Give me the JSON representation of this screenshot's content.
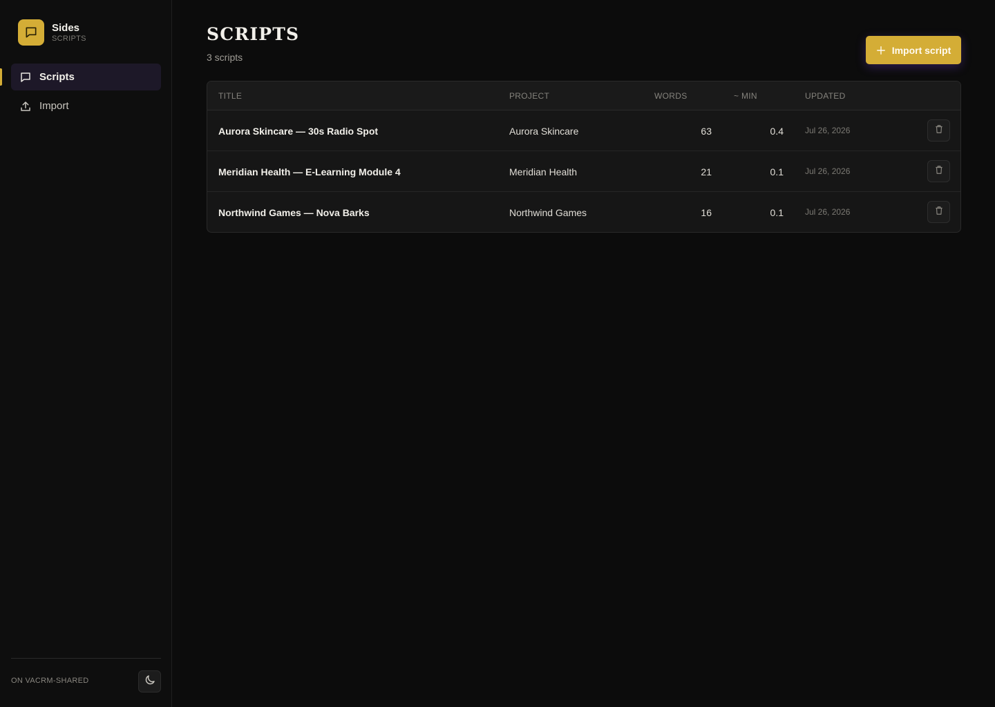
{
  "brand": {
    "name": "Sides",
    "subtitle": "SCRIPTS",
    "logo_icon": "chat-bubble-icon",
    "accent": "#d4ad36"
  },
  "nav": {
    "items": [
      {
        "label": "Scripts",
        "icon": "chat-bubble-icon",
        "active": true
      },
      {
        "label": "Import",
        "icon": "upload-icon",
        "active": false
      }
    ]
  },
  "footer": {
    "label": "ON VACRM-SHARED",
    "theme_icon": "moon-icon"
  },
  "header": {
    "title": "SCRIPTS",
    "count": "3 scripts",
    "import_label": "Import script"
  },
  "table": {
    "columns": {
      "title": "TITLE",
      "project": "PROJECT",
      "words": "WORDS",
      "min": "~ MIN",
      "updated": "UPDATED"
    },
    "rows": [
      {
        "title": "Aurora Skincare — 30s Radio Spot",
        "project": "Aurora Skincare",
        "words": "63",
        "min": "0.4",
        "updated": "Jul 26, 2026"
      },
      {
        "title": "Meridian Health — E-Learning Module 4",
        "project": "Meridian Health",
        "words": "21",
        "min": "0.1",
        "updated": "Jul 26, 2026"
      },
      {
        "title": "Northwind Games — Nova Barks",
        "project": "Northwind Games",
        "words": "16",
        "min": "0.1",
        "updated": "Jul 26, 2026"
      }
    ]
  }
}
